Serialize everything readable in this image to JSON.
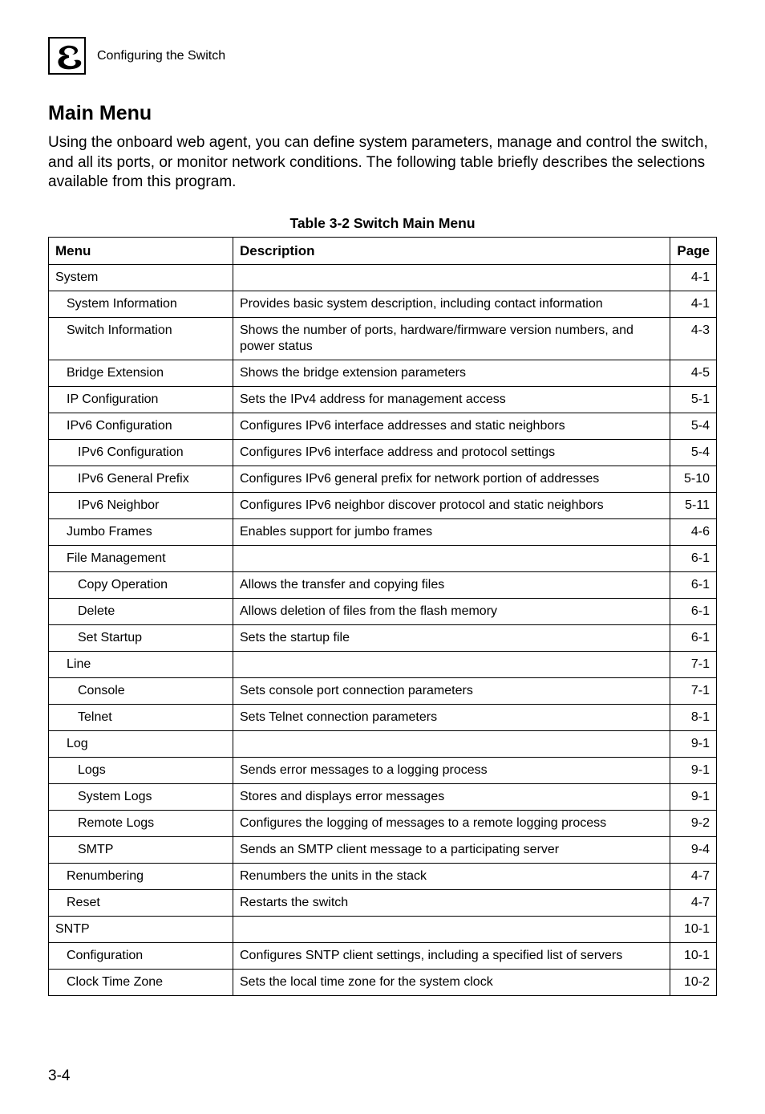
{
  "header": {
    "chapter_number": "3",
    "chapter_title": "Configuring the Switch"
  },
  "section": {
    "title": "Main Menu",
    "intro": "Using the onboard web agent, you can define system parameters, manage and control the switch, and all its ports, or monitor network conditions. The following table briefly describes the selections available from this program."
  },
  "table": {
    "caption": "Table 3-2  Switch Main Menu",
    "headers": {
      "menu": "Menu",
      "description": "Description",
      "page": "Page"
    },
    "rows": [
      {
        "menu": "System",
        "indent": 0,
        "description": "",
        "page": "4-1"
      },
      {
        "menu": "System Information",
        "indent": 1,
        "description": "Provides basic system description, including contact information",
        "page": "4-1"
      },
      {
        "menu": "Switch Information",
        "indent": 1,
        "description": "Shows the number of ports, hardware/firmware version numbers, and power status",
        "page": "4-3"
      },
      {
        "menu": "Bridge Extension",
        "indent": 1,
        "description": "Shows the bridge extension parameters",
        "page": "4-5"
      },
      {
        "menu": "IP Configuration",
        "indent": 1,
        "description": "Sets the IPv4 address for management access",
        "page": "5-1"
      },
      {
        "menu": "IPv6 Configuration",
        "indent": 1,
        "description": "Configures IPv6 interface addresses and static neighbors",
        "page": "5-4"
      },
      {
        "menu": "IPv6 Configuration",
        "indent": 2,
        "description": "Configures IPv6 interface address and protocol settings",
        "page": "5-4"
      },
      {
        "menu": "IPv6 General Prefix",
        "indent": 2,
        "description": "Configures IPv6 general prefix for network portion of addresses",
        "page": "5-10"
      },
      {
        "menu": "IPv6 Neighbor",
        "indent": 2,
        "description": "Configures IPv6 neighbor discover protocol and static neighbors",
        "page": "5-11"
      },
      {
        "menu": "Jumbo Frames",
        "indent": 1,
        "description": "Enables support for jumbo frames",
        "page": "4-6"
      },
      {
        "menu": "File Management",
        "indent": 1,
        "description": "",
        "page": "6-1"
      },
      {
        "menu": "Copy Operation",
        "indent": 2,
        "description": "Allows the transfer and copying files",
        "page": "6-1"
      },
      {
        "menu": "Delete",
        "indent": 2,
        "description": "Allows deletion of files from the flash memory",
        "page": "6-1"
      },
      {
        "menu": "Set Startup",
        "indent": 2,
        "description": "Sets the startup file",
        "page": "6-1"
      },
      {
        "menu": "Line",
        "indent": 1,
        "description": "",
        "page": "7-1"
      },
      {
        "menu": "Console",
        "indent": 2,
        "description": "Sets console port connection parameters",
        "page": "7-1"
      },
      {
        "menu": "Telnet",
        "indent": 2,
        "description": "Sets Telnet connection parameters",
        "page": "8-1"
      },
      {
        "menu": "Log",
        "indent": 1,
        "description": "",
        "page": "9-1"
      },
      {
        "menu": "Logs",
        "indent": 2,
        "description": "Sends error messages to a logging process",
        "page": "9-1"
      },
      {
        "menu": "System Logs",
        "indent": 2,
        "description": "Stores and displays error messages",
        "page": "9-1"
      },
      {
        "menu": "Remote Logs",
        "indent": 2,
        "description": "Configures the logging of messages to a remote logging process",
        "page": "9-2"
      },
      {
        "menu": "SMTP",
        "indent": 2,
        "description": "Sends an SMTP client message to a participating server",
        "page": "9-4"
      },
      {
        "menu": "Renumbering",
        "indent": 1,
        "description": "Renumbers the units in the stack",
        "page": "4-7"
      },
      {
        "menu": "Reset",
        "indent": 1,
        "description": "Restarts the switch",
        "page": "4-7"
      },
      {
        "menu": "SNTP",
        "indent": 0,
        "description": "",
        "page": "10-1"
      },
      {
        "menu": "Configuration",
        "indent": 1,
        "description": "Configures SNTP client settings, including a specified list of servers",
        "page": "10-1"
      },
      {
        "menu": "Clock Time Zone",
        "indent": 1,
        "description": "Sets the local time zone for the system clock",
        "page": "10-2"
      }
    ]
  },
  "page_number": "3-4"
}
